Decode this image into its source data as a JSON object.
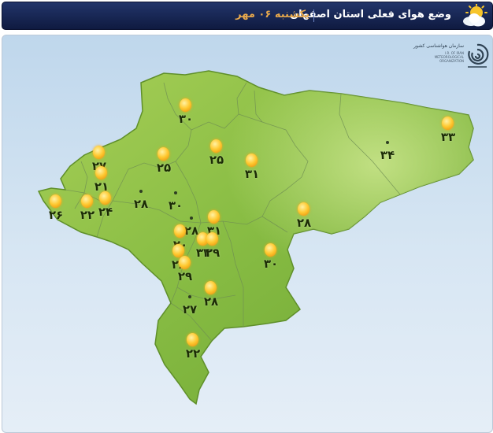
{
  "header": {
    "title": "وضع هوای فعلی استان اصفهان",
    "date": "یکشنبه ۰۶ مهر"
  },
  "organization": {
    "name_fa": "سازمان هواشناسی کشور",
    "name_en_1": "I.R. OF IRAN",
    "name_en_2": "METEOROLOGICAL",
    "name_en_3": "ORGANIZATION"
  },
  "colors": {
    "header_bg": "#1b2c5c",
    "header_date": "#e8a94c",
    "map_land": "#8cc043",
    "map_background": "#cfe1f1",
    "temperature_text": "#1c2c06"
  },
  "icons": {
    "header": "partly-cloudy-icon",
    "station": "sunny-icon",
    "logo": "meteorological-organization-logo"
  },
  "stations": [
    {
      "temp": "۳۰",
      "icon": "sun"
    },
    {
      "temp": "۳۳",
      "icon": "sun"
    },
    {
      "temp": "۳۴",
      "icon": "none"
    },
    {
      "temp": "۲۷",
      "icon": "sun"
    },
    {
      "temp": "۲۵",
      "icon": "sun"
    },
    {
      "temp": "۲۵",
      "icon": "sun"
    },
    {
      "temp": "۳۱",
      "icon": "sun"
    },
    {
      "temp": "۲۱",
      "icon": "sun"
    },
    {
      "temp": "۲۸",
      "icon": "none"
    },
    {
      "temp": "۳۰",
      "icon": "none"
    },
    {
      "temp": "۲۶",
      "icon": "sun"
    },
    {
      "temp": "۲۲",
      "icon": "sun"
    },
    {
      "temp": "۲۴",
      "icon": "sun"
    },
    {
      "temp": "۲۸",
      "icon": "none"
    },
    {
      "temp": "۳۱",
      "icon": "sun"
    },
    {
      "temp": "۲۸",
      "icon": "sun"
    },
    {
      "temp": "۲۰",
      "icon": "sun"
    },
    {
      "temp": "۳۴",
      "icon": "sun"
    },
    {
      "temp": "۲۹",
      "icon": "sun"
    },
    {
      "temp": "۳۰",
      "icon": "sun"
    },
    {
      "temp": "۲۸",
      "icon": "sun"
    },
    {
      "temp": "۲۹",
      "icon": "sun"
    },
    {
      "temp": "۲۷",
      "icon": "none"
    },
    {
      "temp": "۲۸",
      "icon": "sun"
    },
    {
      "temp": "۲۲",
      "icon": "sun"
    }
  ]
}
